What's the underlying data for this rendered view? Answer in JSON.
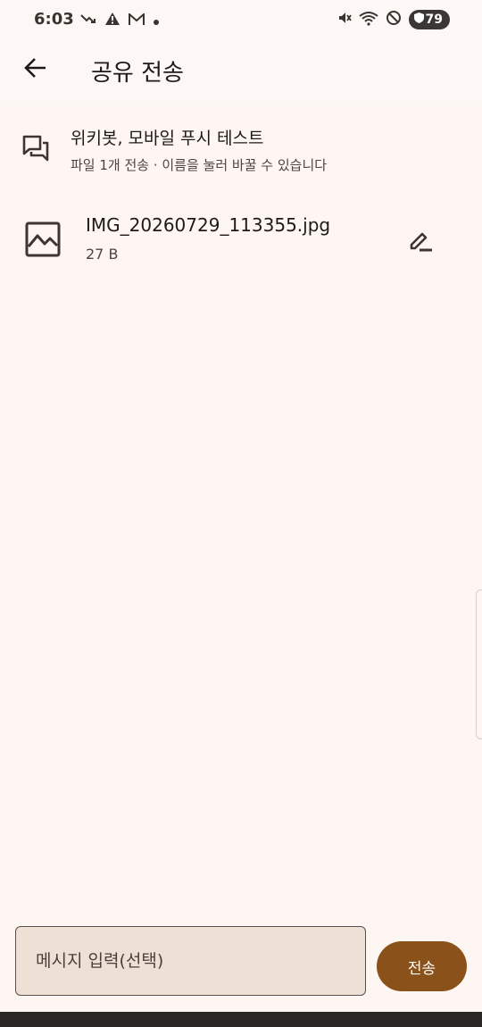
{
  "status_bar": {
    "time": "6:03",
    "left_icons": [
      "missed-call-icon",
      "warning-icon",
      "gmail-icon",
      "dot-icon"
    ],
    "right_icons": [
      "mute-icon",
      "wifi-icon",
      "dnd-icon"
    ],
    "battery_level": "79"
  },
  "app_bar": {
    "title": "공유 전송",
    "back_icon": "arrow-back-icon"
  },
  "target_chat": {
    "icon": "forum-icon",
    "name": "위키봇, 모바일 푸시 테스트",
    "subtitle": "파일 1개 전송 · 이름을 눌러 바꿀 수 있습니다"
  },
  "files": [
    {
      "icon": "image-icon",
      "name": "IMG_20260729_113355.jpg",
      "size": "27 B",
      "action_icon": "edit-icon"
    }
  ],
  "composer": {
    "placeholder": "메시지 입력(선택)",
    "value": "",
    "send_label": "전송"
  },
  "colors": {
    "background": "#fdf6f3",
    "accent": "#8b511a",
    "input_fill": "#efe0d6"
  }
}
